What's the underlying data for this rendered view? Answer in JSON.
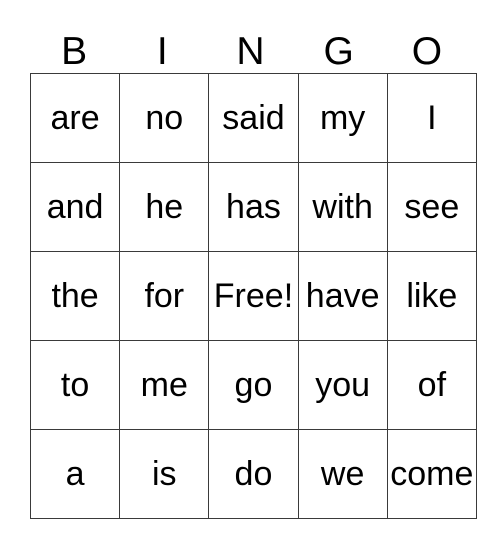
{
  "card": {
    "title": "BINGO",
    "header_letters": [
      "B",
      "I",
      "N",
      "G",
      "O"
    ],
    "grid_rows": [
      [
        "are",
        "no",
        "said",
        "my",
        "I"
      ],
      [
        "and",
        "he",
        "has",
        "with",
        "see"
      ],
      [
        "the",
        "for",
        "Free!",
        "have",
        "like"
      ],
      [
        "to",
        "me",
        "go",
        "you",
        "of"
      ],
      [
        "a",
        "is",
        "do",
        "we",
        "come"
      ]
    ],
    "free_space": "Free!",
    "colors": {
      "background": "#ffffff",
      "text": "#000000",
      "border": "#3a3a3a"
    }
  }
}
